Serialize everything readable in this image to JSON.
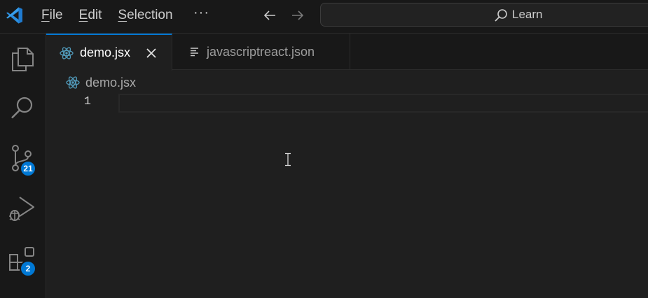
{
  "menu": {
    "items": [
      {
        "mnemonic": "F",
        "rest": "ile"
      },
      {
        "mnemonic": "E",
        "rest": "dit"
      },
      {
        "mnemonic": "S",
        "rest": "election"
      }
    ],
    "more": "···"
  },
  "command_center": {
    "label": "Learn",
    "icon": "search-icon"
  },
  "activity_bar": {
    "explorer": {
      "icon": "files-icon"
    },
    "search": {
      "icon": "search-icon"
    },
    "source_control": {
      "icon": "source-control-icon",
      "badge": "21"
    },
    "run_debug": {
      "icon": "run-debug-icon"
    },
    "extensions": {
      "icon": "extensions-icon",
      "badge": "2"
    }
  },
  "tabs": [
    {
      "label": "demo.jsx",
      "icon": "react-icon",
      "active": true
    },
    {
      "label": "javascriptreact.json",
      "icon": "lines-icon",
      "active": false
    }
  ],
  "breadcrumb": {
    "label": "demo.jsx",
    "icon": "react-icon"
  },
  "editor": {
    "line_numbers": [
      "1"
    ]
  },
  "colors": {
    "accent": "#0078d4",
    "react": "#519aba",
    "background": "#1f1f1f",
    "chrome": "#181818"
  }
}
